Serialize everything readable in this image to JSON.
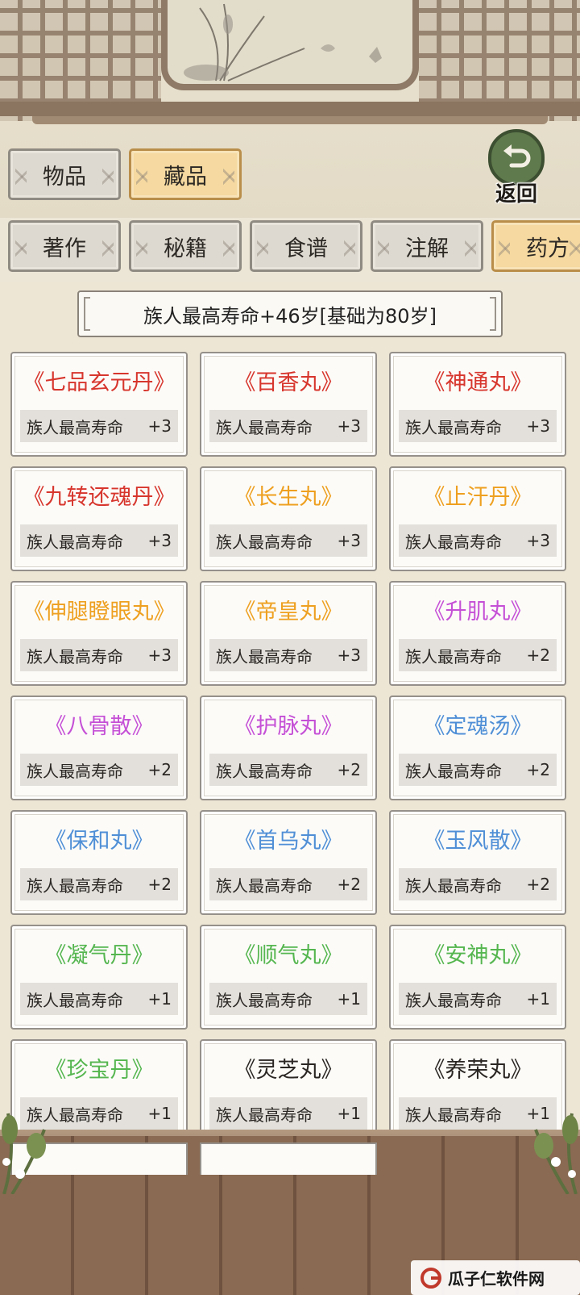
{
  "top_tabs": [
    {
      "label": "物品",
      "active": false
    },
    {
      "label": "藏品",
      "active": true
    }
  ],
  "back_button": {
    "label": "返回"
  },
  "sub_tabs": [
    {
      "label": "著作",
      "active": false
    },
    {
      "label": "秘籍",
      "active": false
    },
    {
      "label": "食谱",
      "active": false
    },
    {
      "label": "注解",
      "active": false
    },
    {
      "label": "药方",
      "active": true
    }
  ],
  "summary": "族人最高寿命+46岁[基础为80岁]",
  "stat_label": "族人最高寿命",
  "items": [
    {
      "name": "《七品玄元丹》",
      "value": "+3",
      "color": "#d7362d"
    },
    {
      "name": "《百香丸》",
      "value": "+3",
      "color": "#d7362d"
    },
    {
      "name": "《神通丸》",
      "value": "+3",
      "color": "#d7362d"
    },
    {
      "name": "《九转还魂丹》",
      "value": "+3",
      "color": "#d7362d"
    },
    {
      "name": "《长生丸》",
      "value": "+3",
      "color": "#eea020"
    },
    {
      "name": "《止汗丹》",
      "value": "+3",
      "color": "#eea020"
    },
    {
      "name": "《伸腿瞪眼丸》",
      "value": "+3",
      "color": "#eea020"
    },
    {
      "name": "《帝皇丸》",
      "value": "+3",
      "color": "#eea020"
    },
    {
      "name": "《升肌丸》",
      "value": "+2",
      "color": "#c550d6"
    },
    {
      "name": "《八骨散》",
      "value": "+2",
      "color": "#c550d6"
    },
    {
      "name": "《护脉丸》",
      "value": "+2",
      "color": "#c550d6"
    },
    {
      "name": "《定魂汤》",
      "value": "+2",
      "color": "#4f8fd6"
    },
    {
      "name": "《保和丸》",
      "value": "+2",
      "color": "#4f8fd6"
    },
    {
      "name": "《首乌丸》",
      "value": "+2",
      "color": "#4f8fd6"
    },
    {
      "name": "《玉风散》",
      "value": "+2",
      "color": "#4f8fd6"
    },
    {
      "name": "《凝气丹》",
      "value": "+1",
      "color": "#55b64f"
    },
    {
      "name": "《顺气丸》",
      "value": "+1",
      "color": "#55b64f"
    },
    {
      "name": "《安神丸》",
      "value": "+1",
      "color": "#55b64f"
    },
    {
      "name": "《珍宝丹》",
      "value": "+1",
      "color": "#55b64f"
    },
    {
      "name": "《灵芝丸》",
      "value": "+1",
      "color": "#2a2623"
    },
    {
      "name": "《养荣丸》",
      "value": "+1",
      "color": "#2a2623"
    }
  ],
  "watermark": "瓜子仁软件网"
}
